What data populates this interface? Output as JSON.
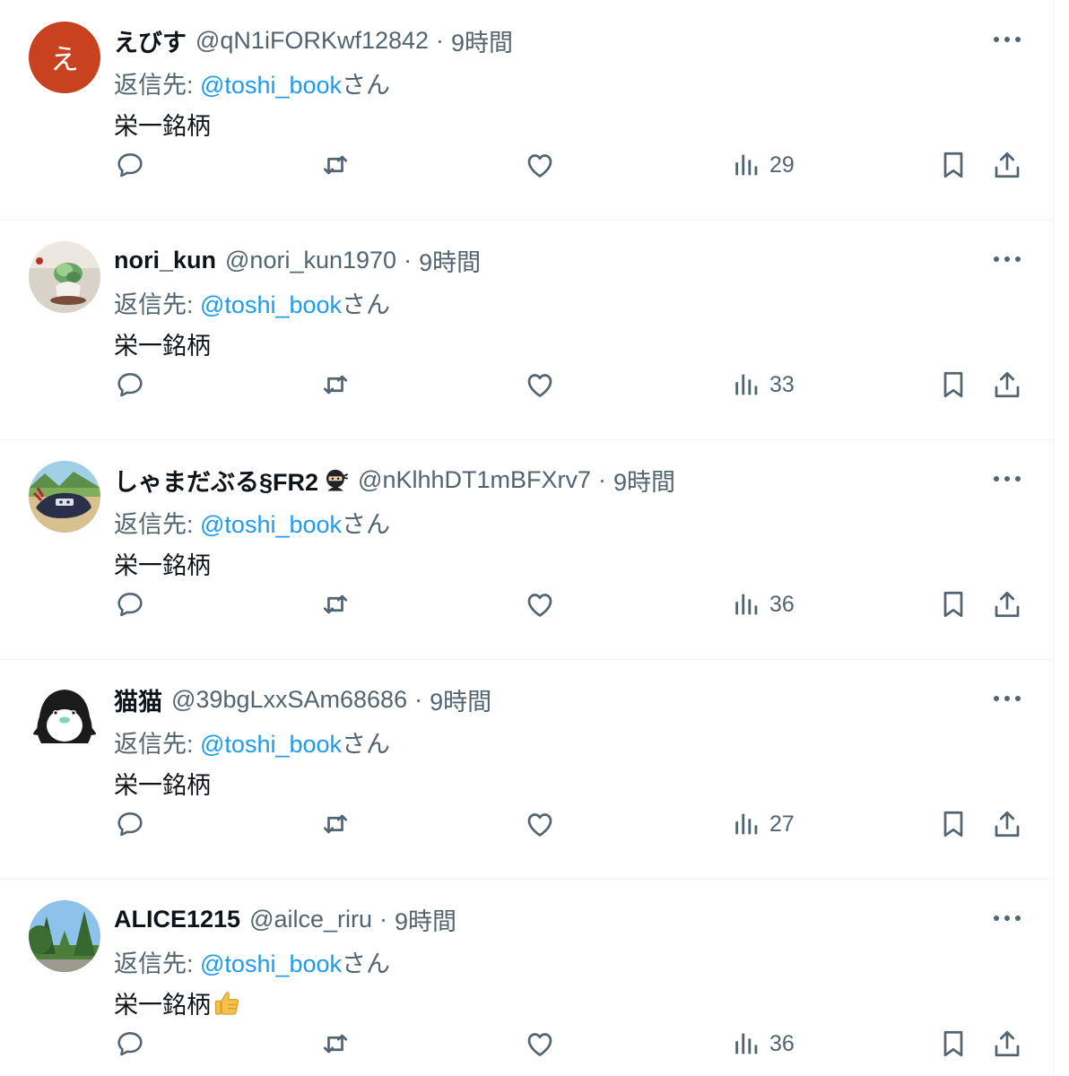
{
  "tweets": [
    {
      "avatar_letter": "え",
      "name": "えびす",
      "handle": "@qN1iFORKwf12842",
      "separator": "·",
      "time": "9時間",
      "reply_prefix": "返信先: ",
      "reply_mention": "@toshi_book",
      "reply_suffix": "さん",
      "text": "栄一銘柄",
      "views": "29"
    },
    {
      "name": "nori_kun",
      "handle": "@nori_kun1970",
      "separator": "·",
      "time": "9時間",
      "reply_prefix": "返信先: ",
      "reply_mention": "@toshi_book",
      "reply_suffix": "さん",
      "text": "栄一銘柄",
      "views": "33"
    },
    {
      "name": "しゃまだぶる§FR2",
      "handle": "@nKlhhDT1mBFXrv7",
      "separator": "·",
      "time": "9時間",
      "reply_prefix": "返信先: ",
      "reply_mention": "@toshi_book",
      "reply_suffix": "さん",
      "text": "栄一銘柄",
      "views": "36"
    },
    {
      "name": "猫猫",
      "handle": "@39bgLxxSAm68686",
      "separator": "·",
      "time": "9時間",
      "reply_prefix": "返信先: ",
      "reply_mention": "@toshi_book",
      "reply_suffix": "さん",
      "text": "栄一銘柄",
      "views": "27"
    },
    {
      "name": "ALICE1215",
      "handle": "@ailce_riru",
      "separator": "·",
      "time": "9時間",
      "reply_prefix": "返信先: ",
      "reply_mention": "@toshi_book",
      "reply_suffix": "さん",
      "text": "栄一銘柄",
      "views": "36"
    }
  ],
  "colors": {
    "text_primary": "#0f1419",
    "text_secondary": "#536471",
    "mention": "#1d9bf0",
    "divider": "#eff3f4",
    "avatar_letter_bg": "#c8421f"
  },
  "icons": {
    "reply": "reply-icon",
    "retweet": "retweet-icon",
    "like": "heart-icon",
    "views": "views-icon",
    "bookmark": "bookmark-icon",
    "share": "share-icon",
    "more": "more-icon",
    "ninja": "ninja-emoji-icon",
    "thumbs_up": "thumbs-up-emoji-icon"
  }
}
